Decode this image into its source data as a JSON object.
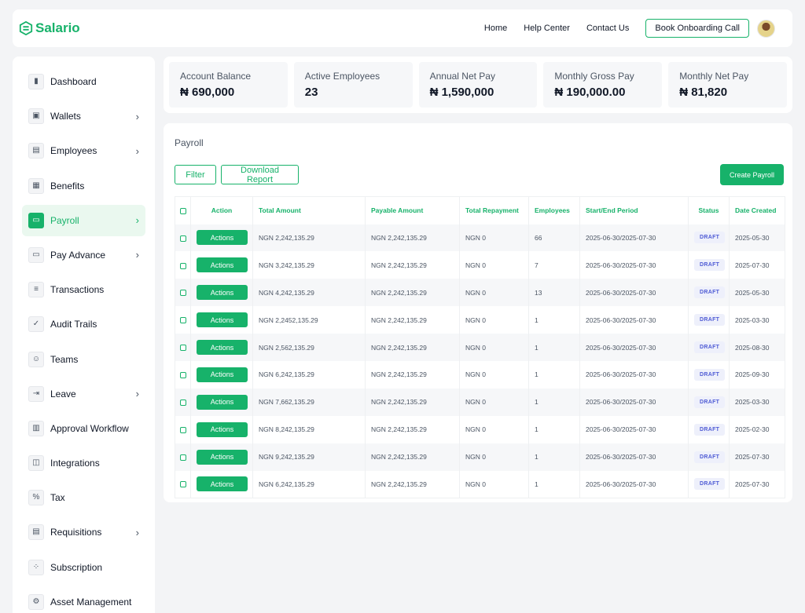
{
  "brand": {
    "name": "Salario",
    "color": "#17b26a"
  },
  "nav": {
    "links": [
      "Home",
      "Help Center",
      "Contact Us"
    ],
    "cta": "Book Onboarding Call"
  },
  "sidebar": {
    "items": [
      {
        "label": "Dashboard",
        "icon": "bar-chart-icon",
        "chevron": false,
        "active": false
      },
      {
        "label": "Wallets",
        "icon": "wallet-icon",
        "chevron": true,
        "active": false
      },
      {
        "label": "Employees",
        "icon": "id-card-icon",
        "chevron": true,
        "active": false
      },
      {
        "label": "Benefits",
        "icon": "gift-icon",
        "chevron": false,
        "active": false
      },
      {
        "label": "Payroll",
        "icon": "payroll-icon",
        "chevron": true,
        "active": true
      },
      {
        "label": "Pay Advance",
        "icon": "card-icon",
        "chevron": true,
        "active": false
      },
      {
        "label": "Transactions",
        "icon": "receipt-icon",
        "chevron": false,
        "active": false
      },
      {
        "label": "Audit Trails",
        "icon": "clipboard-check-icon",
        "chevron": false,
        "active": false
      },
      {
        "label": "Teams",
        "icon": "team-icon",
        "chevron": false,
        "active": false
      },
      {
        "label": "Leave",
        "icon": "leave-icon",
        "chevron": true,
        "active": false
      },
      {
        "label": "Approval Workflow",
        "icon": "workflow-icon",
        "chevron": false,
        "active": false
      },
      {
        "label": "Integrations",
        "icon": "integration-icon",
        "chevron": false,
        "active": false
      },
      {
        "label": "Tax",
        "icon": "tax-icon",
        "chevron": false,
        "active": false
      },
      {
        "label": "Requisitions",
        "icon": "document-icon",
        "chevron": true,
        "active": false
      },
      {
        "label": "Subscription",
        "icon": "nodes-icon",
        "chevron": false,
        "active": false
      },
      {
        "label": "Asset Management",
        "icon": "gear-icon",
        "chevron": false,
        "active": false
      }
    ]
  },
  "stats": [
    {
      "label": "Account Balance",
      "value": "₦ 690,000"
    },
    {
      "label": "Active Employees",
      "value": "23"
    },
    {
      "label": "Annual Net Pay",
      "value": "₦ 1,590,000"
    },
    {
      "label": "Monthly Gross Pay",
      "value": "₦ 190,000.00"
    },
    {
      "label": "Monthly Net Pay",
      "value": "₦ 81,820"
    }
  ],
  "payroll": {
    "title": "Payroll",
    "filter_label": "Filter",
    "download_label": "Download Report",
    "create_label": "Create Payroll",
    "action_label": "Actions",
    "columns": [
      "Action",
      "Total Amount",
      "Payable Amount",
      "Total Repayment",
      "Employees",
      "Start/End Period",
      "Status",
      "Date Created"
    ],
    "rows": [
      {
        "total": "NGN 2,242,135.29",
        "payable": "NGN 2,242,135.29",
        "repayment": "NGN 0",
        "employees": "66",
        "period": "2025-06-30/2025-07-30",
        "status": "DRAFT",
        "created": "2025-05-30"
      },
      {
        "total": "NGN 3,242,135.29",
        "payable": "NGN 2,242,135.29",
        "repayment": "NGN 0",
        "employees": "7",
        "period": "2025-06-30/2025-07-30",
        "status": "DRAFT",
        "created": "2025-07-30"
      },
      {
        "total": "NGN 4,242,135.29",
        "payable": "NGN 2,242,135.29",
        "repayment": "NGN 0",
        "employees": "13",
        "period": "2025-06-30/2025-07-30",
        "status": "DRAFT",
        "created": "2025-05-30"
      },
      {
        "total": "NGN 2,2452,135.29",
        "payable": "NGN 2,242,135.29",
        "repayment": "NGN 0",
        "employees": "1",
        "period": "2025-06-30/2025-07-30",
        "status": "DRAFT",
        "created": "2025-03-30"
      },
      {
        "total": "NGN 2,562,135.29",
        "payable": "NGN 2,242,135.29",
        "repayment": "NGN 0",
        "employees": "1",
        "period": "2025-06-30/2025-07-30",
        "status": "DRAFT",
        "created": "2025-08-30"
      },
      {
        "total": "NGN 6,242,135.29",
        "payable": "NGN 2,242,135.29",
        "repayment": "NGN 0",
        "employees": "1",
        "period": "2025-06-30/2025-07-30",
        "status": "DRAFT",
        "created": "2025-09-30"
      },
      {
        "total": "NGN 7,662,135.29",
        "payable": "NGN 2,242,135.29",
        "repayment": "NGN 0",
        "employees": "1",
        "period": "2025-06-30/2025-07-30",
        "status": "DRAFT",
        "created": "2025-03-30"
      },
      {
        "total": "NGN 8,242,135.29",
        "payable": "NGN 2,242,135.29",
        "repayment": "NGN 0",
        "employees": "1",
        "period": "2025-06-30/2025-07-30",
        "status": "DRAFT",
        "created": "2025-02-30"
      },
      {
        "total": "NGN 9,242,135.29",
        "payable": "NGN 2,242,135.29",
        "repayment": "NGN 0",
        "employees": "1",
        "period": "2025-06-30/2025-07-30",
        "status": "DRAFT",
        "created": "2025-07-30"
      },
      {
        "total": "NGN 6,242,135.29",
        "payable": "NGN 2,242,135.29",
        "repayment": "NGN 0",
        "employees": "1",
        "period": "2025-06-30/2025-07-30",
        "status": "DRAFT",
        "created": "2025-07-30"
      }
    ]
  }
}
